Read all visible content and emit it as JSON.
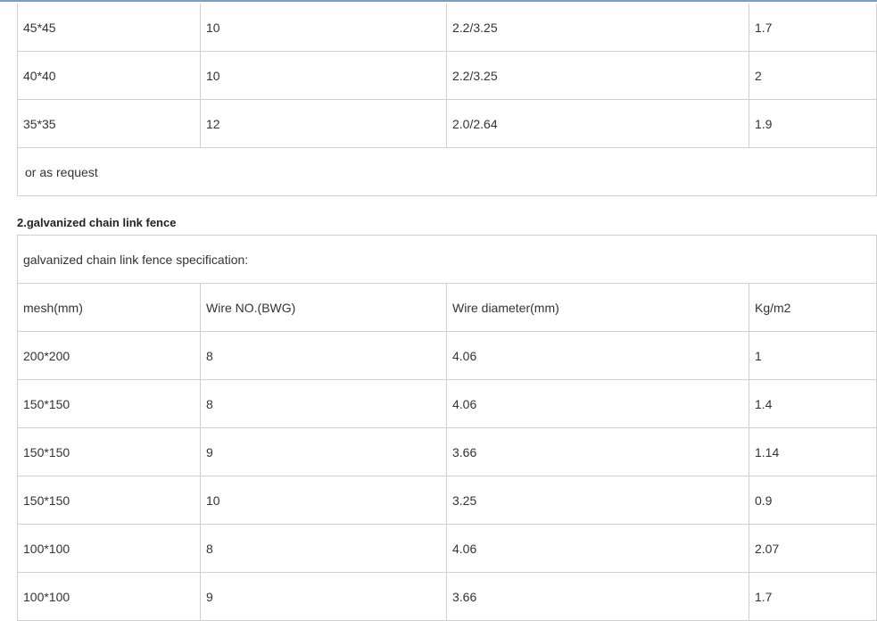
{
  "table1": {
    "rows": [
      {
        "mesh": "45*45",
        "wire_no": "10",
        "wire_diameter": "2.2/3.25",
        "weight": "1.7"
      },
      {
        "mesh": "40*40",
        "wire_no": "10",
        "wire_diameter": "2.2/3.25",
        "weight": "2"
      },
      {
        "mesh": "35*35",
        "wire_no": "12",
        "wire_diameter": "2.0/2.64",
        "weight": "1.9"
      }
    ],
    "footer_note": "or as request"
  },
  "section2": {
    "heading": "2.galvanized chain link fence",
    "caption": "galvanized chain link fence specification:",
    "headers": {
      "mesh": "mesh(mm)",
      "wire_no": "Wire NO.(BWG)",
      "wire_diameter": "Wire diameter(mm)",
      "weight": "Kg/m2"
    },
    "rows": [
      {
        "mesh": "200*200",
        "wire_no": "8",
        "wire_diameter": "4.06",
        "weight": "1"
      },
      {
        "mesh": "150*150",
        "wire_no": "8",
        "wire_diameter": "4.06",
        "weight": "1.4"
      },
      {
        "mesh": "150*150",
        "wire_no": "9",
        "wire_diameter": "3.66",
        "weight": "1.14"
      },
      {
        "mesh": "150*150",
        "wire_no": "10",
        "wire_diameter": "3.25",
        "weight": "0.9"
      },
      {
        "mesh": "100*100",
        "wire_no": "8",
        "wire_diameter": "4.06",
        "weight": "2.07"
      },
      {
        "mesh": "100*100",
        "wire_no": "9",
        "wire_diameter": "3.66",
        "weight": "1.7"
      }
    ]
  },
  "colors": {
    "border": "#cfcfcf",
    "text": "#333333",
    "top_rule": "#7a9cc6"
  }
}
